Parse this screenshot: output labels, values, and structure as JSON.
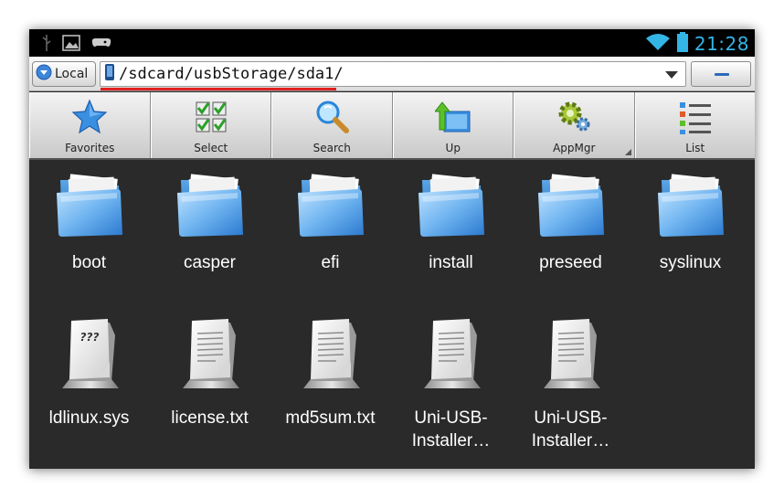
{
  "status_bar": {
    "time": "21:28",
    "icons": [
      "usb-icon",
      "image-icon",
      "game-controller-icon",
      "wifi-icon",
      "battery-icon"
    ],
    "time_color": "#33b5e5"
  },
  "address_bar": {
    "location_button": "Local",
    "path": "/sdcard/usbStorage/sda1/",
    "highlight_color": "#e02020"
  },
  "toolbar": {
    "buttons": [
      {
        "label": "Favorites",
        "icon": "star-icon"
      },
      {
        "label": "Select",
        "icon": "checklist-icon"
      },
      {
        "label": "Search",
        "icon": "magnifier-icon"
      },
      {
        "label": "Up",
        "icon": "folder-up-icon"
      },
      {
        "label": "AppMgr",
        "icon": "gears-icon"
      },
      {
        "label": "List",
        "icon": "list-view-icon"
      }
    ]
  },
  "folders": [
    {
      "name": "boot",
      "icon": "folder-icon"
    },
    {
      "name": "casper",
      "icon": "folder-icon"
    },
    {
      "name": "efi",
      "icon": "folder-icon"
    },
    {
      "name": "install",
      "icon": "folder-icon"
    },
    {
      "name": "preseed",
      "icon": "folder-icon"
    },
    {
      "name": "syslinux",
      "icon": "folder-icon"
    }
  ],
  "files": [
    {
      "name_line1": "ldlinux.sys",
      "name_line2": "",
      "icon": "unknown-file-icon"
    },
    {
      "name_line1": "license.txt",
      "name_line2": "",
      "icon": "text-file-icon"
    },
    {
      "name_line1": "md5sum.txt",
      "name_line2": "",
      "icon": "text-file-icon"
    },
    {
      "name_line1": "Uni-USB-",
      "name_line2": "Installer…",
      "icon": "text-file-icon"
    },
    {
      "name_line1": "Uni-USB-",
      "name_line2": "Installer…",
      "icon": "text-file-icon"
    }
  ]
}
